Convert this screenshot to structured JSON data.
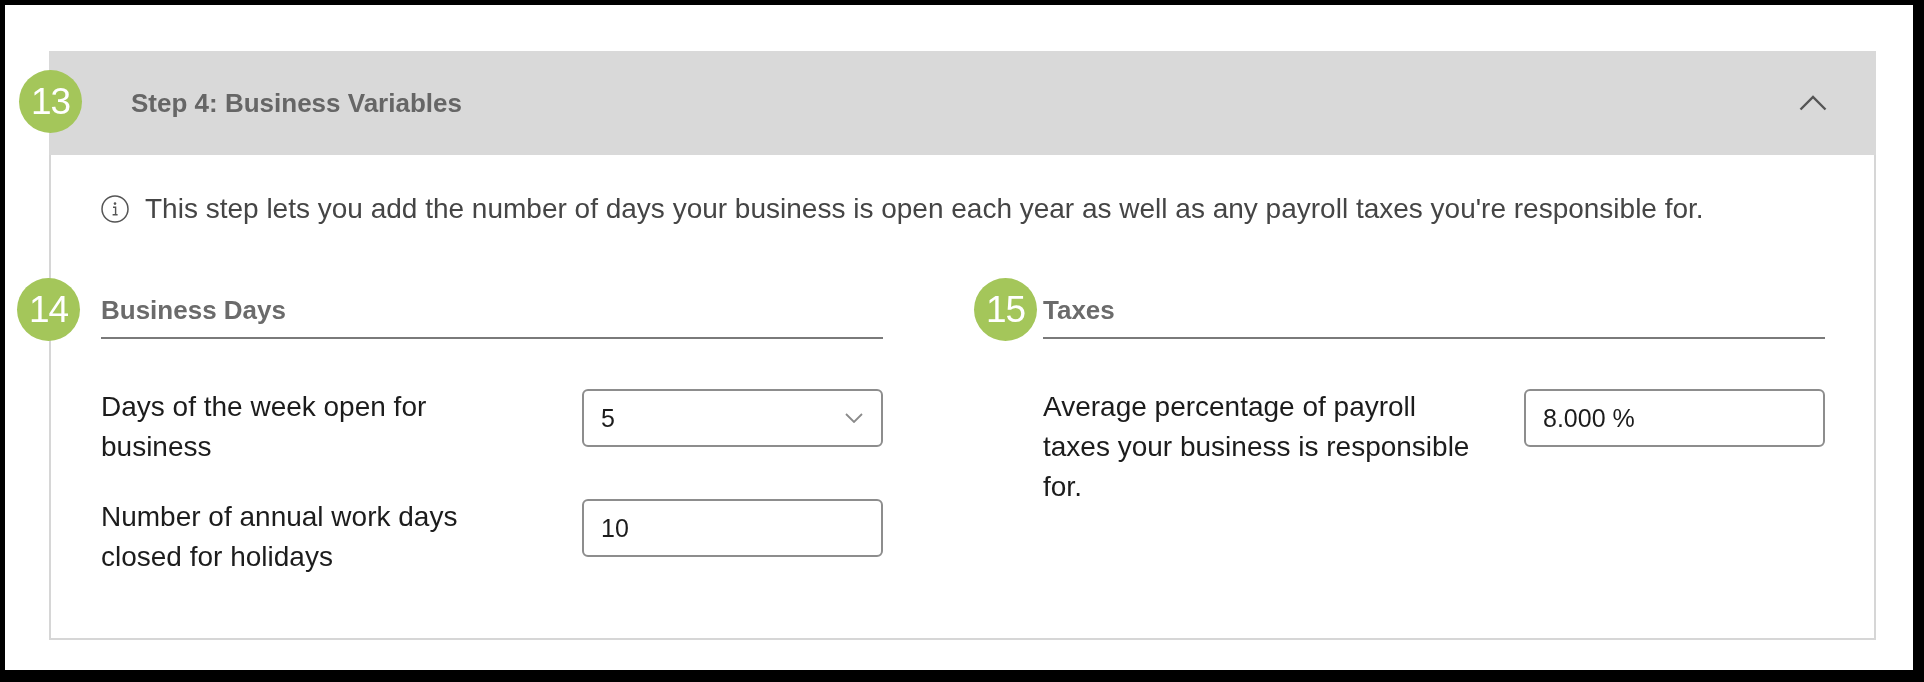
{
  "step": {
    "badge": "13",
    "title": "Step 4: Business Variables",
    "expanded": true
  },
  "info": "This step lets you add the number of days your business is open each year as well as any payroll taxes you're responsible for.",
  "sections": [
    {
      "badge": "14",
      "title": "Business Days",
      "fields": [
        {
          "kind": "select",
          "label": "Days of the week open for business",
          "value": "5"
        },
        {
          "kind": "input",
          "label": "Number of annual work days closed for holidays",
          "value": "10"
        }
      ]
    },
    {
      "badge": "15",
      "title": "Taxes",
      "fields": [
        {
          "kind": "input",
          "label": "Average percentage of payroll taxes your business is responsible for.",
          "value": "8.000 %"
        }
      ]
    }
  ]
}
